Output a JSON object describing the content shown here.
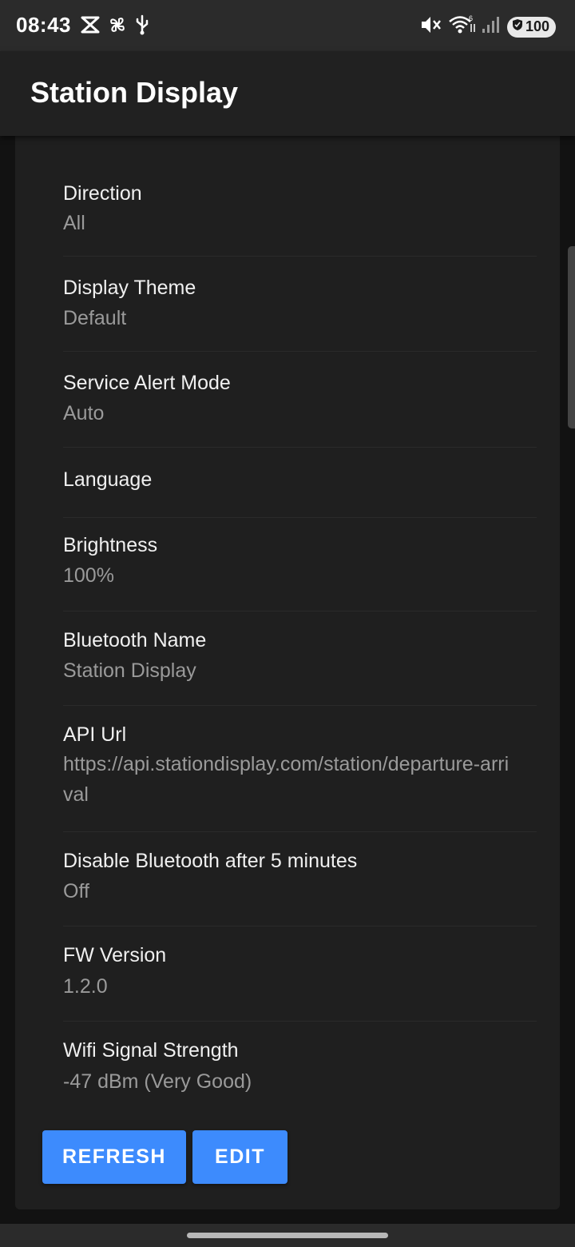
{
  "status_bar": {
    "time": "08:43",
    "battery_level": "100",
    "left_icons": [
      "cut-icon",
      "fan-icon",
      "usb-icon"
    ],
    "right_icons": [
      "mute-icon",
      "wifi-icon",
      "signal-icon",
      "battery-icon"
    ]
  },
  "app_bar": {
    "title": "Station Display"
  },
  "settings": [
    {
      "label": "Direction",
      "value": "All"
    },
    {
      "label": "Display Theme",
      "value": "Default"
    },
    {
      "label": "Service Alert Mode",
      "value": "Auto"
    },
    {
      "label": "Language",
      "value": ""
    },
    {
      "label": "Brightness",
      "value": "100%"
    },
    {
      "label": "Bluetooth Name",
      "value": "Station Display"
    },
    {
      "label": "API Url",
      "value": "https://api.stationdisplay.com/station/departure-arrival"
    },
    {
      "label": "Disable Bluetooth after 5 minutes",
      "value": "Off"
    },
    {
      "label": "FW Version",
      "value": "1.2.0"
    },
    {
      "label": "Wifi Signal Strength",
      "value": "-47 dBm (Very Good)"
    }
  ],
  "actions": {
    "refresh_label": "REFRESH",
    "edit_label": "EDIT"
  },
  "colors": {
    "background": "#121212",
    "card": "#1f1f1f",
    "app_bar": "#212121",
    "primary_button": "#3d8bfd",
    "label_text": "#f0f0f0",
    "value_text": "#9a9a9a"
  }
}
